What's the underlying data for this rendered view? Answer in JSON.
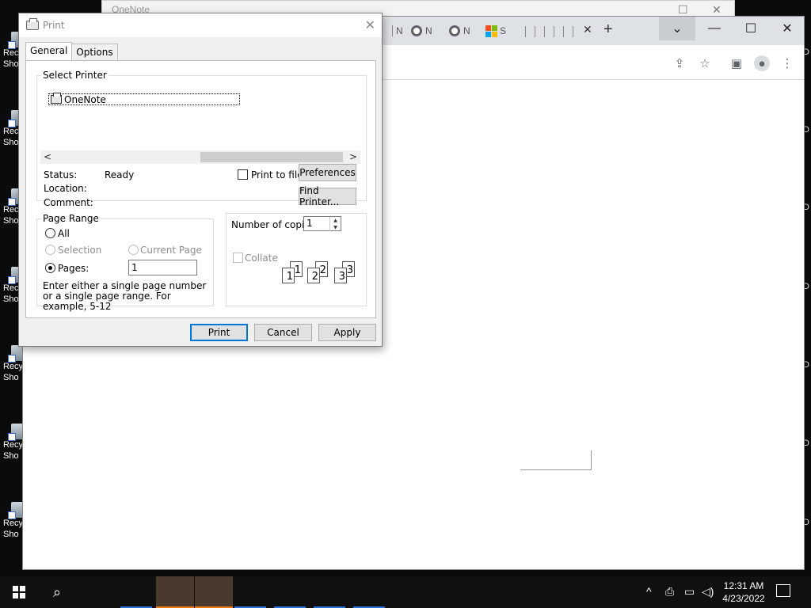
{
  "desktop": {
    "icons": [
      {
        "label": "Rec\nSho"
      },
      {
        "label": "Rec\nSho"
      },
      {
        "label": "Rec\nSho"
      },
      {
        "label": "Rec\nSho"
      },
      {
        "label": "Recy\nSho"
      },
      {
        "label": "Recy\nSho"
      },
      {
        "label": "Recy\nSho"
      }
    ],
    "right_edge_letter": "D"
  },
  "background_window": {
    "title": "OneNote"
  },
  "chrome": {
    "tabs": [
      {
        "label": "N",
        "favicon": "chrome-icon"
      },
      {
        "label": "N",
        "favicon": "chrome-icon"
      },
      {
        "label": "N",
        "favicon": "chrome-icon"
      },
      {
        "label": "S",
        "favicon": "microsoft-icon"
      }
    ],
    "tab_close": "✕",
    "new_tab": "+",
    "window_controls": {
      "dropdown": "⌄",
      "minimize": "—",
      "maximize": "☐",
      "close": "✕"
    },
    "toolbar_icons": [
      "share-icon",
      "star-icon",
      "sidebar-icon",
      "profile-icon",
      "menu-icon"
    ]
  },
  "print_dialog": {
    "title": "Print",
    "tabs": [
      {
        "label": "General",
        "active": true
      },
      {
        "label": "Options",
        "active": false
      }
    ],
    "select_printer": {
      "legend": "Select Printer",
      "printers": [
        {
          "name": "OneNote",
          "selected": true
        }
      ],
      "status_label": "Status:",
      "status_value": "Ready",
      "location_label": "Location:",
      "location_value": "",
      "comment_label": "Comment:",
      "comment_value": "",
      "print_to_file_label": "Print to file",
      "print_to_file_checked": false,
      "preferences_button": "Preferences",
      "find_printer_button": "Find Printer..."
    },
    "page_range": {
      "legend": "Page Range",
      "all_label": "All",
      "selection_label": "Selection",
      "current_page_label": "Current Page",
      "pages_label": "Pages:",
      "pages_value": "1",
      "selected": "pages",
      "hint": "Enter either a single page number or a single page range.  For example, 5-12"
    },
    "copies": {
      "label": "Number of copies:",
      "value": "1",
      "collate_label": "Collate",
      "collate_checked": false,
      "collate_sets": [
        [
          "1",
          "1"
        ],
        [
          "2",
          "2"
        ],
        [
          "3",
          "3"
        ]
      ]
    },
    "buttons": {
      "print": "Print",
      "cancel": "Cancel",
      "apply": "Apply"
    }
  },
  "taskbar": {
    "apps": [
      {
        "name": "app-1",
        "accent": "#2d6fd6"
      },
      {
        "name": "app-2",
        "accent": "#e87b18",
        "active": true
      },
      {
        "name": "app-3",
        "accent": "#e87b18",
        "active": true
      },
      {
        "name": "app-4",
        "accent": "#2d6fd6"
      },
      {
        "name": "app-5",
        "accent": "#2d6fd6"
      },
      {
        "name": "app-6",
        "accent": "#2d6fd6"
      },
      {
        "name": "app-7",
        "accent": "#2d6fd6"
      }
    ],
    "tray_icons": [
      "chevron-up-icon",
      "printer-icon",
      "network-icon",
      "volume-icon"
    ],
    "time": "12:31 AM",
    "date": "4/23/2022"
  }
}
